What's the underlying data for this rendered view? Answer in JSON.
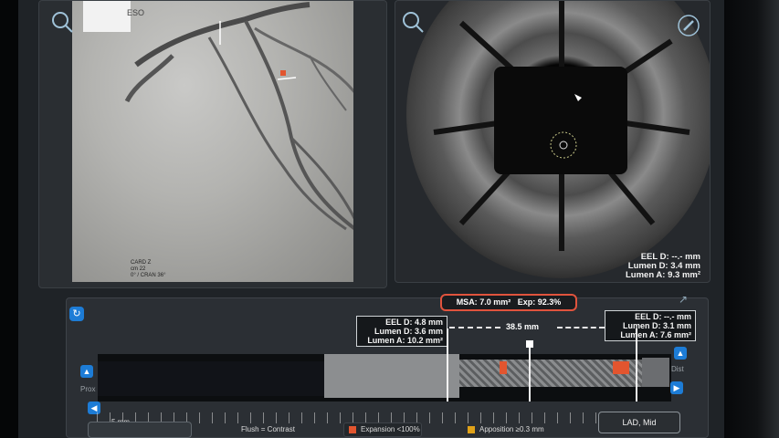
{
  "angio": {
    "label": "ESO",
    "meta_lines": [
      "CARD Z",
      "cm 22",
      "0° / CRAN 36°"
    ]
  },
  "ivus": {
    "readout": [
      {
        "label": "EEL D:",
        "value": "--.- mm"
      },
      {
        "label": "Lumen D:",
        "value": "3.4 mm"
      },
      {
        "label": "Lumen A:",
        "value": "9.3 mm²"
      }
    ]
  },
  "summary": {
    "msa_label": "MSA:",
    "msa_value": "7.0 mm²",
    "exp_label": "Exp:",
    "exp_value": "92.3%"
  },
  "left_measure": {
    "eel": "EEL D:  4.8 mm",
    "lumen_d": "Lumen D:  3.6 mm",
    "lumen_a": "Lumen A: 10.2 mm²"
  },
  "right_measure": {
    "eel": "EEL D:  --.- mm",
    "lumen_d": "Lumen D:  3.1 mm",
    "lumen_a": "Lumen A:  7.6 mm²"
  },
  "length": "38.5 mm",
  "labels": {
    "prox": "Prox",
    "dist": "Dist"
  },
  "scale": "5 mm",
  "legend": {
    "flush": "Flush = Contrast",
    "expansion": "Expansion <100%",
    "apposition": "Apposition ≥0.3 mm"
  },
  "segment": "LAD, Mid",
  "colors": {
    "expansion": "#e2552f",
    "apposition": "#e0a219",
    "accent": "#1d7cd6"
  },
  "icons": {
    "zoom": "magnifier-icon",
    "edit": "pencil-icon",
    "refresh": "refresh-icon",
    "up": "chevron-up-icon",
    "down": "chevron-down-icon",
    "left": "chevron-left-icon",
    "right": "chevron-right-icon"
  }
}
